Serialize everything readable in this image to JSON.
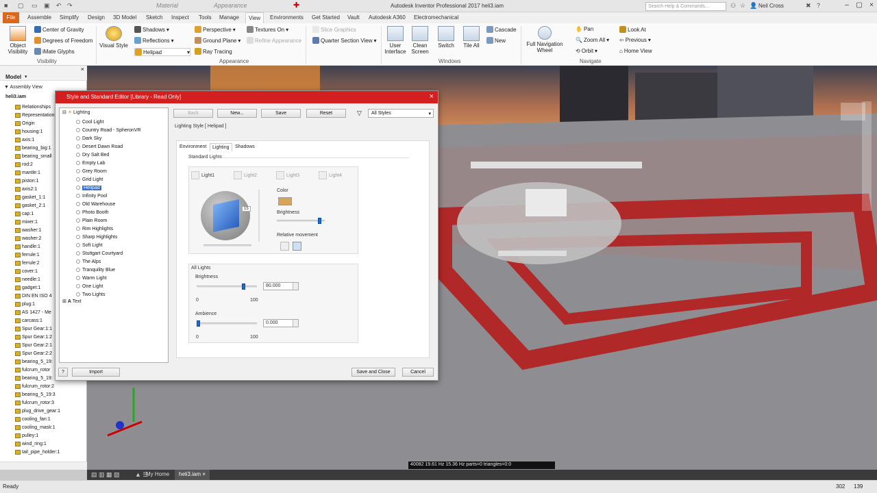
{
  "app": {
    "title": "Autodesk Inventor Professional 2017    heli3.iam",
    "search_placeholder": "Search Help & Commands...",
    "user": "Neil Cross",
    "material_field": "Material",
    "appearance_field": "Appearance"
  },
  "tabs": [
    "File",
    "Assemble",
    "Simplify",
    "Design",
    "3D Model",
    "Sketch",
    "Inspect",
    "Tools",
    "Manage",
    "View",
    "Environments",
    "Get Started",
    "Vault",
    "Autodesk A360",
    "Electromechanical"
  ],
  "ribbon": {
    "object_visibility": "Object\nVisibility",
    "center_of_gravity": "Center of Gravity",
    "degrees_of_freedom": "Degrees of Freedom",
    "imate_glyphs": "iMate Glyphs",
    "group_visibility": "Visibility",
    "visual_style": "Visual Style",
    "shadows": "Shadows",
    "reflections": "Reflections",
    "helipad": "Helipad",
    "perspective": "Perspective",
    "ground_plane": "Ground Plane",
    "ray_tracing": "Ray Tracing",
    "textures_on": "Textures On",
    "refine_appearance": "Refine Appearance",
    "group_appearance": "Appearance",
    "slice_graphics": "Slice Graphics",
    "quarter_section_view": "Quarter Section View",
    "user_interface": "User\nInterface",
    "clean_screen": "Clean\nScreen",
    "switch": "Switch",
    "tile_all": "Tile All",
    "cascade": "Cascade",
    "new": "New",
    "group_windows": "Windows",
    "full_navigation_wheel": "Full Navigation\nWheel",
    "pan": "Pan",
    "zoom_all": "Zoom All",
    "orbit": "Orbit",
    "look_at": "Look At",
    "previous": "Previous",
    "home_view": "Home View",
    "group_navigate": "Navigate"
  },
  "browser": {
    "title": "Model",
    "assembly_view": "Assembly View",
    "root": "heli3.iam",
    "items": [
      "Relationships",
      "Representations",
      "Origin",
      "housing:1",
      "axis:1",
      "bearing_big:1",
      "bearing_small",
      "rod:2",
      "mantle:1",
      "piston:1",
      "axis2:1",
      "gasket_1:1",
      "gasket_2:1",
      "cap:1",
      "mixer:1",
      "washer:1",
      "washer:2",
      "handle:1",
      "ferrule:1",
      "ferrule:2",
      "cover:1",
      "needle:1",
      "gadget:1",
      "DIN EN ISO 4",
      "plug:1",
      "AS 1427 - Me",
      "carcass:1",
      "Spur Gear:1:1",
      "Spur Gear:1:2",
      "Spur Gear:2:1",
      "Spur Gear:2:2",
      "bearing_5_19:",
      "fulcrum_rotor",
      "bearing_5_19:",
      "fulcrum_rotor:2",
      "bearing_5_19:3",
      "fulcrum_rotor:3",
      "plug_drive_gear:1",
      "cooling_fan:1",
      "cooling_mask:1",
      "pulley:1",
      "wind_ring:1",
      "tail_pipe_holder:1"
    ]
  },
  "viewport": {
    "stats": "40082  19.61 Hz  15.36 Hz  parts=0 triangles=0:0"
  },
  "doc_tabs": {
    "home": "My Home",
    "file": "heli3.iam"
  },
  "status": {
    "left": "Ready",
    "n1": "302",
    "n2": "139"
  },
  "dialog": {
    "title": "Style and Standard Editor [Library - Read Only]",
    "tree_root": "Lighting",
    "styles": [
      "Cool Light",
      "Country Road - SpheronVR",
      "Dark Sky",
      "Desert Dawn Road",
      "Dry Salt Bed",
      "Empty Lab",
      "Grey Room",
      "Grid Light",
      "Helipad",
      "Infinity Pool",
      "Old Warehouse",
      "Photo Booth",
      "Plain Room",
      "Rim Highlights",
      "Sharp Highlights",
      "Soft Light",
      "Stuttgart Courtyard",
      "The Alps",
      "Tranquility Blue",
      "Warm Light",
      "One Light",
      "Two Lights"
    ],
    "selected_style": "Helipad",
    "text_node": "Text",
    "back": "Back",
    "new": "New...",
    "save": "Save",
    "reset": "Reset",
    "filter": "All Styles",
    "style_label": "Lighting Style [ Helipad ]",
    "tab_environment": "Environment",
    "tab_lighting": "Lighting",
    "tab_shadows": "Shadows",
    "standard_lights": "Standard Lights",
    "lights": [
      "Light1",
      "Light2",
      "Light3",
      "Light4"
    ],
    "sphere_tooltip": "15",
    "color_label": "Color",
    "light_color": "#d4a55a",
    "brightness_label": "Brightness",
    "light_brightness": 0.92,
    "relative_movement": "Relative movement",
    "all_lights": "All Lights",
    "all_brightness_label": "Brightness",
    "all_brightness_value": "80.000",
    "all_brightness_fraction": 0.8,
    "range_min": "0",
    "range_max": "100",
    "ambience_label": "Ambience",
    "ambience_value": "0.000",
    "ambience_fraction": 0.0,
    "import": "Import",
    "save_and_close": "Save and Close",
    "cancel": "Cancel"
  }
}
